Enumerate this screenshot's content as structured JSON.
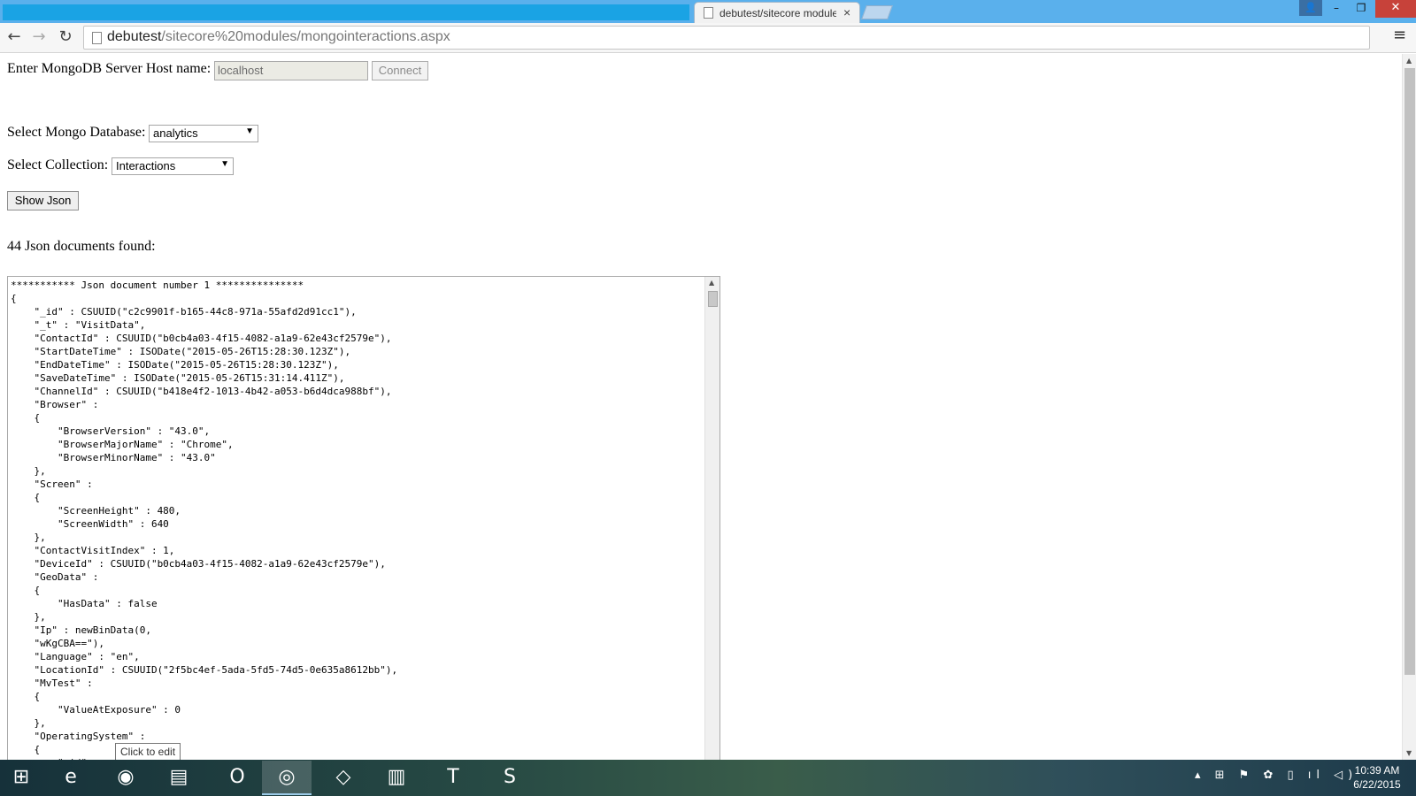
{
  "browser": {
    "tab_title": "debutest/sitecore module",
    "tab_close": "×",
    "url_host": "debutest",
    "url_path": "/sitecore%20modules/mongointeractions.aspx",
    "window_min": "–",
    "window_max": "❐",
    "window_close": "✕",
    "back": "←",
    "forward": "→",
    "reload": "↻",
    "star": "☆",
    "menu": "≡",
    "user_icon": "👤",
    "ext_icon": "M"
  },
  "form": {
    "host_label": "Enter MongoDB Server Host name:",
    "host_value": "localhost",
    "connect_label": "Connect",
    "db_label": "Select Mongo Database:",
    "db_selected": "analytics",
    "collection_label": "Select Collection:",
    "collection_selected": "Interactions",
    "show_json_label": "Show Json",
    "found_text": "44 Json documents found:"
  },
  "json_output": "*********** Json document number 1 ***************\n{\n    \"_id\" : CSUUID(\"c2c9901f-b165-44c8-971a-55afd2d91cc1\"),\n    \"_t\" : \"VisitData\",\n    \"ContactId\" : CSUUID(\"b0cb4a03-4f15-4082-a1a9-62e43cf2579e\"),\n    \"StartDateTime\" : ISODate(\"2015-05-26T15:28:30.123Z\"),\n    \"EndDateTime\" : ISODate(\"2015-05-26T15:28:30.123Z\"),\n    \"SaveDateTime\" : ISODate(\"2015-05-26T15:31:14.411Z\"),\n    \"ChannelId\" : CSUUID(\"b418e4f2-1013-4b42-a053-b6d4dca988bf\"),\n    \"Browser\" :\n    {\n        \"BrowserVersion\" : \"43.0\",\n        \"BrowserMajorName\" : \"Chrome\",\n        \"BrowserMinorName\" : \"43.0\"\n    },\n    \"Screen\" :\n    {\n        \"ScreenHeight\" : 480,\n        \"ScreenWidth\" : 640\n    },\n    \"ContactVisitIndex\" : 1,\n    \"DeviceId\" : CSUUID(\"b0cb4a03-4f15-4082-a1a9-62e43cf2579e\"),\n    \"GeoData\" :\n    {\n        \"HasData\" : false\n    },\n    \"Ip\" : newBinData(0,\n    \"wKgCBA==\"),\n    \"Language\" : \"en\",\n    \"LocationId\" : CSUUID(\"2f5bc4ef-5ada-5fd5-74d5-0e635a8612bb\"),\n    \"MvTest\" :\n    {\n        \"ValueAtExposure\" : 0\n    },\n    \"OperatingSystem\" :\n    {\n        \"_id\" : ",
  "tooltip": "Click to edit",
  "taskbar": {
    "start_glyph": "⊞",
    "apps": [
      {
        "name": "internet-explorer",
        "glyph": "e"
      },
      {
        "name": "app-2",
        "glyph": "◉"
      },
      {
        "name": "file-explorer",
        "glyph": "▤"
      },
      {
        "name": "outlook",
        "glyph": "O"
      },
      {
        "name": "chrome",
        "glyph": "◎"
      },
      {
        "name": "visual-studio",
        "glyph": "◇"
      },
      {
        "name": "app-7",
        "glyph": "▥"
      },
      {
        "name": "app-8",
        "glyph": "T"
      },
      {
        "name": "skype",
        "glyph": "S"
      }
    ],
    "tray_glyphs": "▴ ⊞ ⚑ ✿ ▯ ıl ◁)",
    "time": "10:39 AM",
    "date": "6/22/2015"
  }
}
